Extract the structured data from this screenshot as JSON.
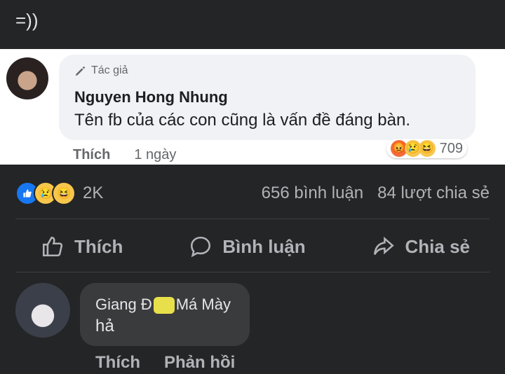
{
  "post": {
    "text": "=))"
  },
  "embedded_comment": {
    "badge": "Tác giả",
    "name": "Nguyen Hong Nhung",
    "body": "Tên fb của các con cũng là vấn đề đáng bàn.",
    "reaction_count": "709",
    "reaction_icons": [
      "angry-icon",
      "sad-icon",
      "haha-icon"
    ],
    "like_label": "Thích",
    "time": "1 ngày"
  },
  "stats": {
    "reaction_icons": [
      "like-icon",
      "sad-icon",
      "haha-icon"
    ],
    "reaction_total": "2K",
    "comments": "656 bình luận",
    "shares": "84 lượt chia sẻ"
  },
  "actions": {
    "like": "Thích",
    "comment": "Bình luận",
    "share": "Chia sẻ"
  },
  "comment": {
    "name_first": "Giang Đ",
    "name_last": "Má Mày",
    "text": "hả",
    "like_label": "Thích",
    "reply_label": "Phản hồi"
  },
  "colors": {
    "background": "#242526",
    "comment_bubble": "#3a3b3c",
    "muted_text": "#b0b3b8",
    "like_blue": "#1877f2"
  }
}
